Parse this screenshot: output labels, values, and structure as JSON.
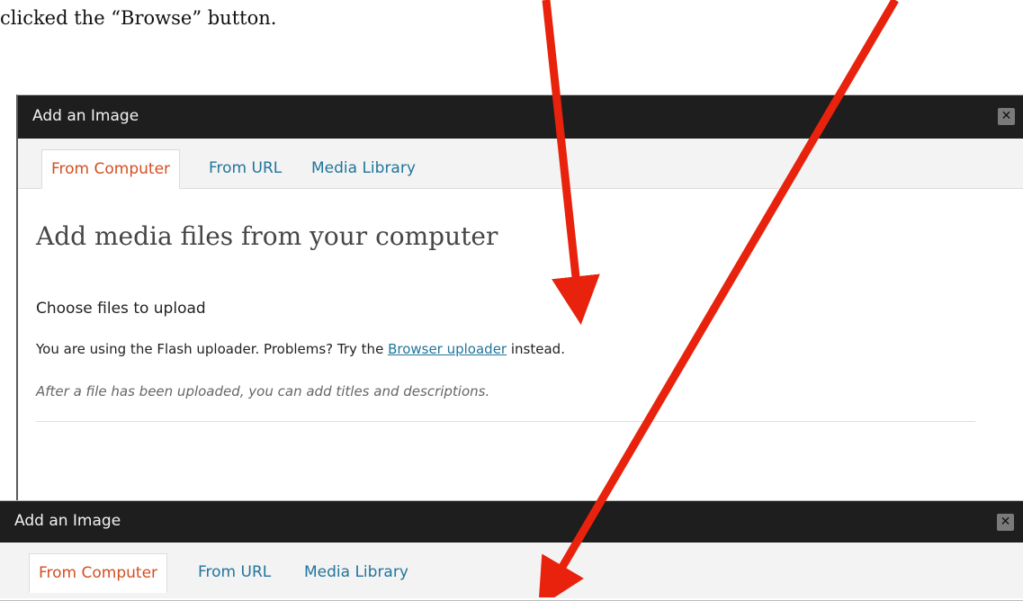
{
  "caption": "clicked the “Browse” button.",
  "dialog_top": {
    "title": "Add an Image",
    "close_glyph": "✕",
    "tabs": [
      {
        "label": "From Computer"
      },
      {
        "label": "From URL"
      },
      {
        "label": "Media Library"
      }
    ],
    "heading": "Add media files from your computer",
    "subheading": "Choose files to upload",
    "info_prefix": "You are using the Flash uploader. Problems? Try the ",
    "info_link": "Browser uploader",
    "info_suffix": " instead.",
    "note": "After a file has been uploaded, you can add titles and descriptions."
  },
  "dialog_bottom": {
    "title": "Add an Image",
    "close_glyph": "✕",
    "tabs": [
      {
        "label": "From Computer"
      },
      {
        "label": "From URL"
      },
      {
        "label": "Media Library"
      }
    ]
  },
  "colors": {
    "arrow": "#e8220c",
    "link": "#21759b",
    "active_tab": "#d54e21",
    "titlebar": "#1e1e1e"
  }
}
